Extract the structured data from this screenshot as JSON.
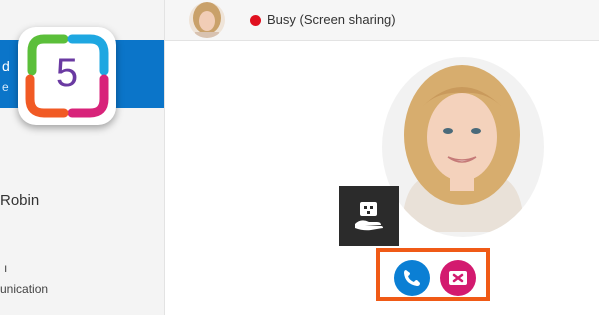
{
  "step": {
    "number": "5"
  },
  "sidebar": {
    "selected": {
      "line1": "d",
      "line2": "e"
    },
    "contact_name": "Robin",
    "note": {
      "line1": "ı",
      "line2": "unication"
    }
  },
  "status": {
    "state": "Busy (Screen sharing)",
    "dot_color": "#e0101f"
  },
  "call": {
    "accept_icon": "phone-icon",
    "decline_icon": "decline-icon",
    "share_icon": "screen-share-icon"
  },
  "colors": {
    "accent_blue": "#0b75c9",
    "highlight_orange": "#f05a16",
    "decline_magenta": "#d31a6f"
  }
}
